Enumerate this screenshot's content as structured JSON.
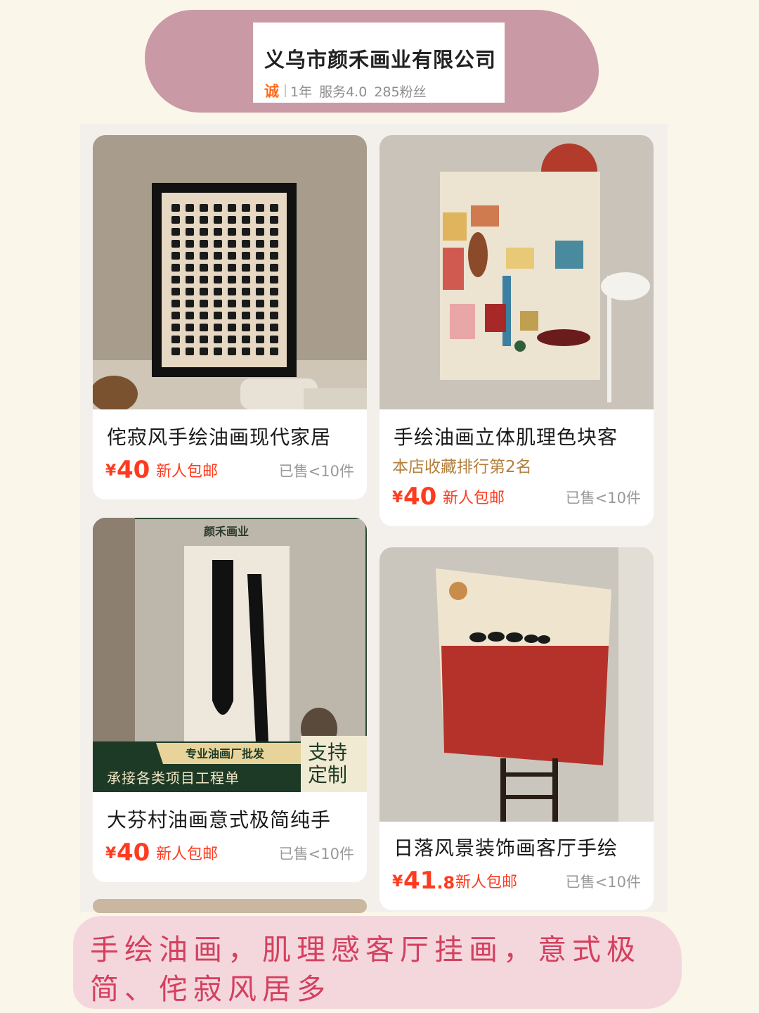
{
  "store": {
    "name": "义乌市颜禾画业有限公司",
    "badge": "诚",
    "years": "1年",
    "service": "服务4.0",
    "fans": "285粉丝"
  },
  "products": [
    {
      "title": "侘寂风手绘油画现代家居",
      "price_symbol": "¥",
      "price_int": "40",
      "price_dec": "",
      "promo": "新人包邮",
      "sold": "已售<10件"
    },
    {
      "title": "手绘油画立体肌理色块客",
      "rank": "本店收藏排行第2名",
      "price_symbol": "¥",
      "price_int": "40",
      "price_dec": "",
      "promo": "新人包邮",
      "sold": "已售<10件"
    },
    {
      "title": "大芬村油画意式极简纯手",
      "price_symbol": "¥",
      "price_int": "40",
      "price_dec": "",
      "promo": "新人包邮",
      "sold": "已售<10件",
      "overlay": {
        "brand": "颜禾画业",
        "tag": "专业油画厂批发",
        "slogan": "承接各类项目工程单",
        "custom_line1": "支持",
        "custom_line2": "定制"
      }
    },
    {
      "title": "日落风景装饰画客厅手绘",
      "price_symbol": "¥",
      "price_int": "41",
      "price_dec": ".8",
      "promo": "新人包邮",
      "sold": "已售<10件"
    }
  ],
  "caption": "手绘油画，肌理感客厅挂画，意式极简、侘寂风居多",
  "colors": {
    "accent": "#ff3b1f",
    "banner": "#c99aa6",
    "caption_bg": "#f4d7dd",
    "caption_text": "#d4405f",
    "rank": "#b2803c"
  }
}
